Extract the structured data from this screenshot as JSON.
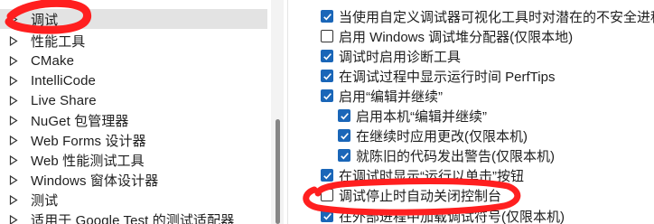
{
  "tree": {
    "items": [
      {
        "label": "调试",
        "selected": true
      },
      {
        "label": "性能工具"
      },
      {
        "label": "CMake"
      },
      {
        "label": "IntelliCode"
      },
      {
        "label": "Live Share"
      },
      {
        "label": "NuGet 包管理器"
      },
      {
        "label": "Web Forms 设计器"
      },
      {
        "label": "Web 性能测试工具"
      },
      {
        "label": "Windows 窗体设计器"
      },
      {
        "label": "测试"
      },
      {
        "label": "适用于 Google Test 的测试适配器"
      }
    ]
  },
  "options": [
    {
      "label": "当使用自定义调试器可视化工具时对潜在的不安全进程",
      "checked": true
    },
    {
      "label": "启用 Windows 调试堆分配器(仅限本地)",
      "checked": false
    },
    {
      "label": "调试时启用诊断工具",
      "checked": true
    },
    {
      "label": "在调试过程中显示运行时间 PerfTips",
      "checked": true
    },
    {
      "label": "启用“编辑并继续”",
      "checked": true
    },
    {
      "label": "启用本机“编辑并继续”",
      "checked": true
    },
    {
      "label": "在继续时应用更改(仅限本机)",
      "checked": true
    },
    {
      "label": "就陈旧的代码发出警告(仅限本机)",
      "checked": true
    },
    {
      "label": "在调试时显示“运行以单击”按钮",
      "checked": true
    },
    {
      "label": "调试停止时自动关闭控制台",
      "checked": false
    },
    {
      "label": "在外部进程中加载调试符号(仅限本机)",
      "checked": true
    }
  ],
  "colors": {
    "accent": "#1a66b8",
    "selection": "#e3e3e3",
    "annotation": "#ff1f1f"
  }
}
